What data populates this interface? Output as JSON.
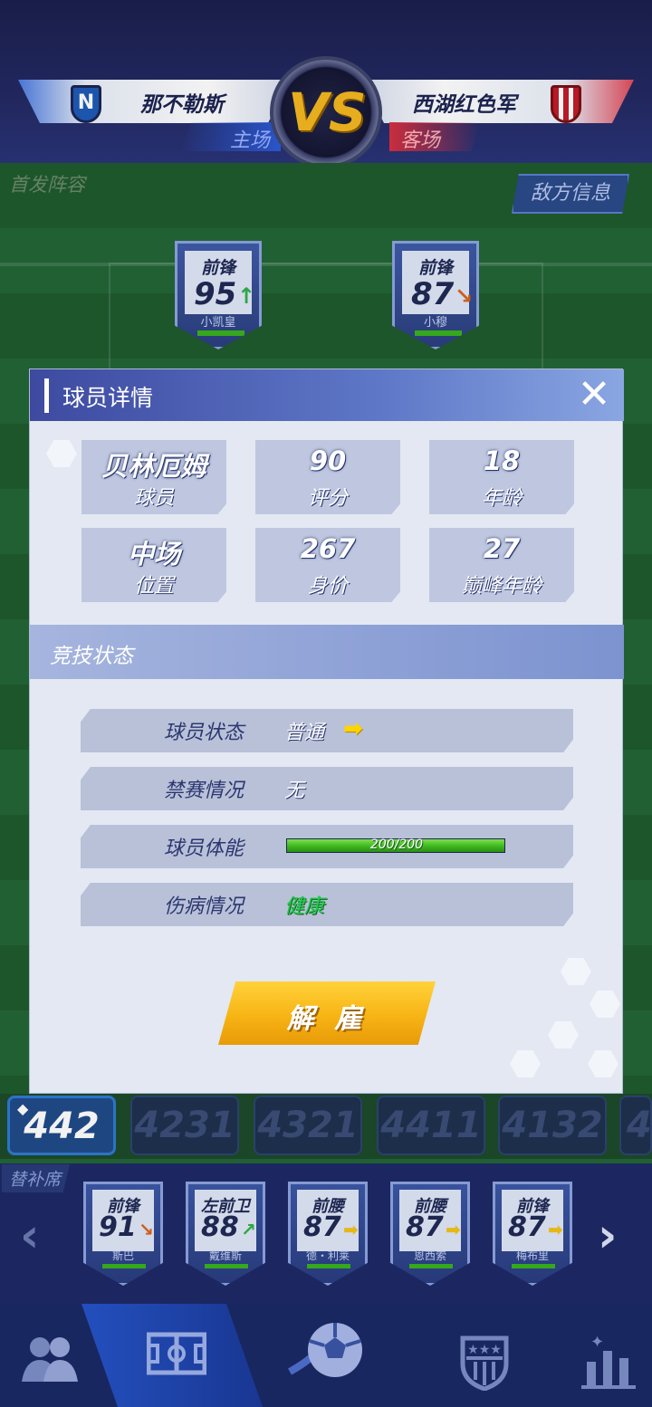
{
  "match": {
    "home_team": "那不勒斯",
    "away_team": "西湖红色军",
    "home_label": "主场",
    "away_label": "客场",
    "vs": "VS"
  },
  "pitch": {
    "lineup_label": "首发阵容",
    "enemy_info_button": "敌方信息",
    "players": [
      {
        "position": "前锋",
        "rating": "95",
        "name": "小凯皇",
        "trend": "up"
      },
      {
        "position": "前锋",
        "rating": "87",
        "name": "小穆",
        "trend": "down"
      }
    ]
  },
  "modal": {
    "title": "球员详情",
    "info": [
      {
        "value": "贝林厄姆",
        "label": "球员"
      },
      {
        "value": "90",
        "label": "评分"
      },
      {
        "value": "18",
        "label": "年龄"
      },
      {
        "value": "中场",
        "label": "位置"
      },
      {
        "value": "267",
        "label": "身价"
      },
      {
        "value": "27",
        "label": "巅峰年龄"
      }
    ],
    "section_title": "竞技状态",
    "status": {
      "form_label": "球员状态",
      "form_value": "普通",
      "ban_label": "禁赛情况",
      "ban_value": "无",
      "stamina_label": "球员体能",
      "stamina_text": "200/200",
      "stamina_fraction": 1.0,
      "injury_label": "伤病情况",
      "injury_value": "健康"
    },
    "fire_button": "解 雇"
  },
  "formations": [
    "442",
    "4231",
    "4321",
    "4411",
    "4132",
    "4"
  ],
  "active_formation": "442",
  "bench": {
    "label": "替补席",
    "players": [
      {
        "position": "前锋",
        "rating": "91",
        "name": "斯巴",
        "trend": "down"
      },
      {
        "position": "左前卫",
        "rating": "88",
        "name": "戴维斯",
        "trend": "up"
      },
      {
        "position": "前腰",
        "rating": "87",
        "name": "德・利莱",
        "trend": "flat"
      },
      {
        "position": "前腰",
        "rating": "87",
        "name": "恩西索",
        "trend": "flat"
      },
      {
        "position": "前锋",
        "rating": "87",
        "name": "梅布里",
        "trend": "flat"
      }
    ]
  },
  "nav": [
    "team-icon",
    "tactics-board-icon",
    "match-ball-icon",
    "club-badge-icon",
    "stats-icon"
  ],
  "colors": {
    "accent_gold": "#f3b720",
    "healthy_green": "#1fd04b",
    "trend_up": "#2fb24a",
    "trend_down": "#d8641c",
    "trend_flat": "#f2c21a"
  }
}
